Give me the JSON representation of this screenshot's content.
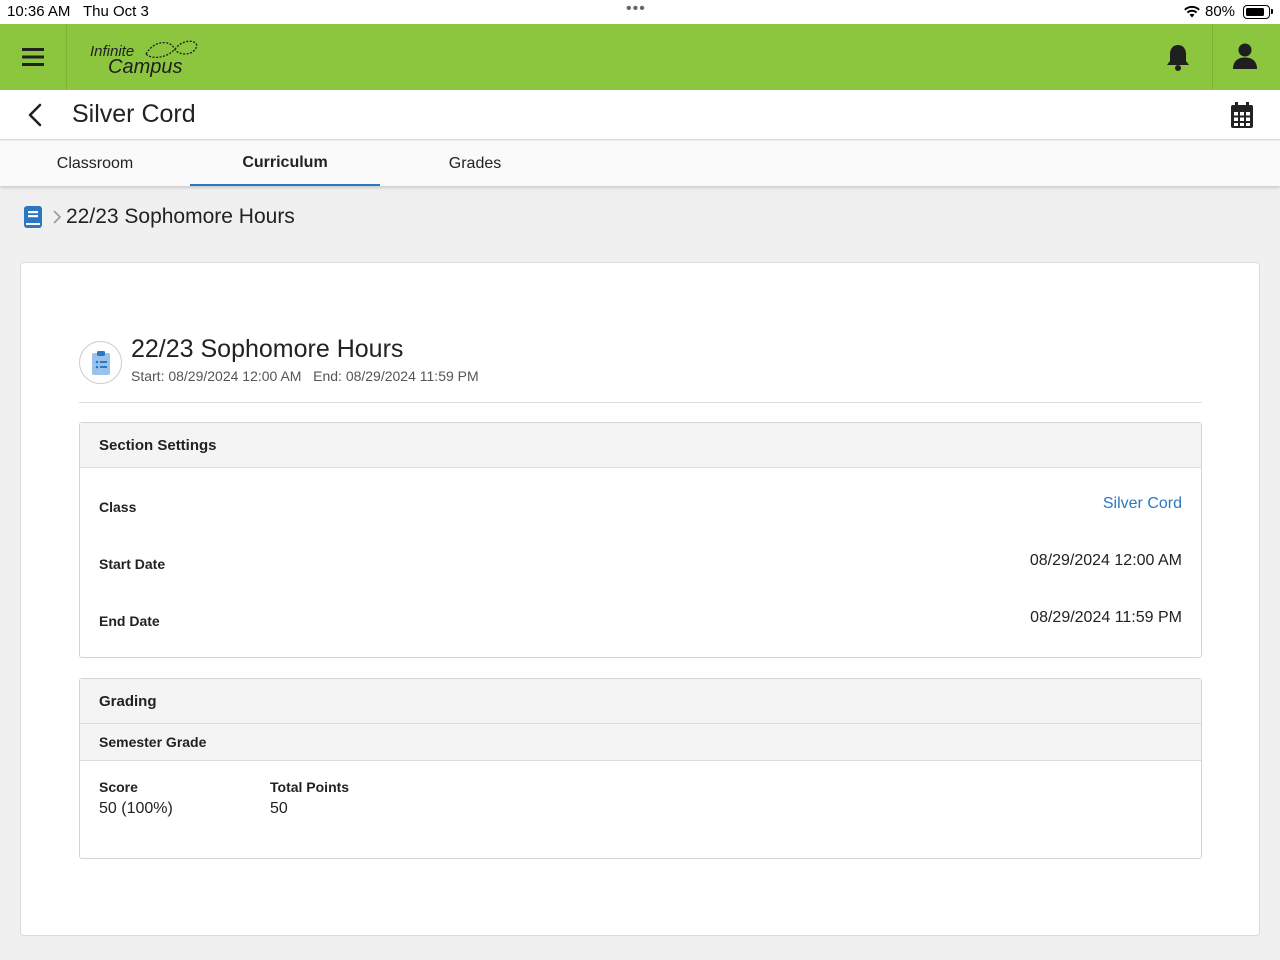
{
  "status_bar": {
    "time": "10:36 AM",
    "date": "Thu Oct 3",
    "battery": "80%",
    "battery_level": 0.8
  },
  "app": {
    "brand_line1": "Infinite",
    "brand_line2": "Campus",
    "header_color": "#8cc63f",
    "accent_color": "#2b77c2"
  },
  "titlebar": {
    "title": "Silver Cord"
  },
  "tabs": [
    {
      "label": "Classroom",
      "active": false
    },
    {
      "label": "Curriculum",
      "active": true
    },
    {
      "label": "Grades",
      "active": false
    }
  ],
  "breadcrumb": {
    "current": "22/23 Sophomore Hours"
  },
  "assignment": {
    "title": "22/23 Sophomore Hours",
    "dates": "Start: 08/29/2024 12:00 AM   End: 08/29/2024 11:59 PM"
  },
  "section_settings": {
    "heading": "Section Settings",
    "rows": [
      {
        "label": "Class",
        "value": "Silver Cord"
      },
      {
        "label": "Start Date",
        "value": "08/29/2024 12:00 AM"
      },
      {
        "label": "End Date",
        "value": "08/29/2024 11:59 PM"
      }
    ]
  },
  "grading": {
    "heading": "Grading",
    "subheading": "Semester Grade",
    "score_label": "Score",
    "score_value": "50 (100%)",
    "total_label": "Total Points",
    "total_value": "50"
  }
}
